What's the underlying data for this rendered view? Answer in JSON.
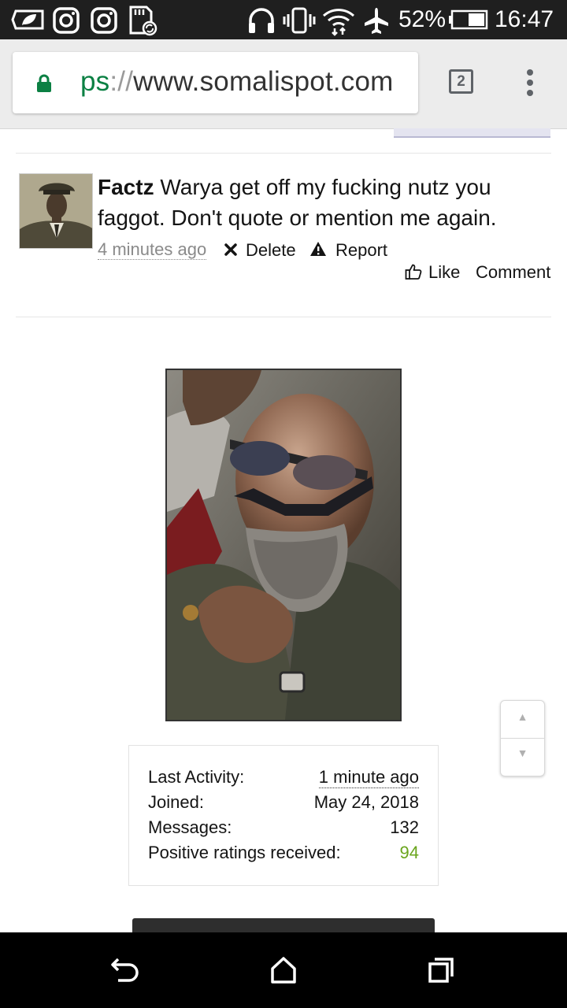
{
  "status_bar": {
    "battery": "52%",
    "time": "16:47",
    "icons": [
      "leaf-icon",
      "instagram-icon",
      "instagram-icon",
      "sd-card-sync-icon",
      "headphones-icon",
      "vibrate-icon",
      "wifi-icon",
      "airplane-mode-icon",
      "battery-icon"
    ]
  },
  "browser": {
    "url_scheme": "ps",
    "url_separator": "://",
    "url_host": "www.somalispot.com",
    "tab_count": "2",
    "icons": [
      "lock-icon",
      "tabs-icon",
      "more-vert-icon"
    ]
  },
  "post": {
    "author": "Factz",
    "message": "Warya get off my fucking nutz you faggot. Don't quote or mention me again.",
    "time": "4 minutes ago",
    "delete_label": "Delete",
    "report_label": "Report",
    "like_label": "Like",
    "comment_label": "Comment"
  },
  "profile_stats": {
    "last_activity_label": "Last Activity:",
    "last_activity_value": "1 minute ago",
    "joined_label": "Joined:",
    "joined_value": "May 24, 2018",
    "messages_label": "Messages:",
    "messages_value": "132",
    "ratings_label": "Positive ratings received:",
    "ratings_value": "94"
  },
  "scroll_control": {
    "up": "▲",
    "down": "▼"
  },
  "colors": {
    "status_bar": "#1f1f1f",
    "secure_scheme": "#0b8043",
    "positive": "#6aa51d",
    "nav_bar": "#000000"
  }
}
